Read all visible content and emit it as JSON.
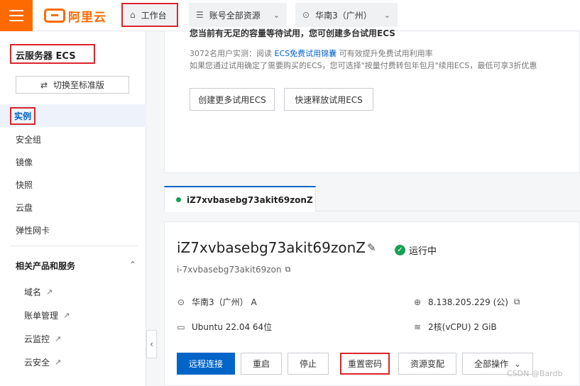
{
  "topbar": {
    "logo_text": "阿里云",
    "workbench": "工作台",
    "resources": "账号全部资源",
    "region": "华南3（广州）"
  },
  "sidebar": {
    "title": "云服务器 ECS",
    "switch_label": "切换至标准版",
    "items": [
      "实例",
      "安全组",
      "镜像",
      "快照",
      "云盘",
      "弹性网卡"
    ],
    "group_title": "相关产品和服务",
    "sub_items": [
      "域名",
      "账单管理",
      "云监控",
      "云安全"
    ]
  },
  "trial_card": {
    "cut_title": "您当前有无足的容量等待试用，您可创建多台试用ECS",
    "line1_prefix": "3072名用户实测：阅读",
    "line1_link": "ECS免费试用锦囊",
    "line1_suffix": "可有效提升免费试用利用率",
    "line2": "如果您通过试用确定了需要购买的ECS，您可选择\"按量付费转包年包月\"续用ECS，最低可享3折优惠",
    "btn_create": "创建更多试用ECS",
    "btn_release": "快速释放试用ECS"
  },
  "tab": {
    "label": "iZ7xvbasebg73akit69zonZ"
  },
  "instance": {
    "name": "iZ7xvbasebg73akit69zonZ",
    "status": "运行中",
    "id": "i-7xvbasebg73akit69zon",
    "zone": "华南3（广州） A",
    "ip": "8.138.205.229 (公)",
    "os": "Ubuntu 22.04 64位",
    "spec": "2核(vCPU)  2 GiB"
  },
  "actions": {
    "remote": "远程连接",
    "restart": "重启",
    "stop": "停止",
    "reset_pwd": "重置密码",
    "change": "资源变配",
    "all_ops": "全部操作"
  },
  "watermark": "CSDN @Bardb",
  "colors": {
    "brand": "#ff6a00",
    "primary": "#0064c8",
    "running": "#18a058",
    "highlight": "#d9262c"
  }
}
